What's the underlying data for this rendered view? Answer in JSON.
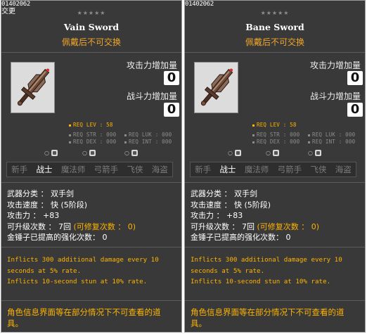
{
  "panels": [
    {
      "item_id": "01402062",
      "sub": "交更",
      "stars": "★★★★★",
      "name": "Vain Sword",
      "trade_note": "佩戴后不可交换",
      "attack_inc_label": "攻击力增加量",
      "attack_inc_value": "0",
      "combat_inc_label": "战斗力增加量",
      "combat_inc_value": "0",
      "req_lev": "REQ LEV :   58",
      "req_str": "REQ STR : 000",
      "req_luk": "REQ LUK : 000",
      "req_dex": "REQ DEX : 000",
      "req_int": "REQ INT : 000",
      "jobs": [
        "新手",
        "战士",
        "魔法师",
        "弓箭手",
        "飞侠",
        "海盗"
      ],
      "active_job": "战士",
      "stats": {
        "category": "武器分类 ： 双手剑",
        "speed": "攻击速度 ： 快 (5阶段)",
        "attack": "攻击力 ： +83",
        "upgrades_prefix": "可升级次数 ： 7回",
        "upgrades_suffix": "(可修复次数 ： 0)",
        "hammer": "金锤子已提高的强化次数： 0"
      },
      "desc_1": " Inflicts 300 additional damage every 10 seconds at 5% rate.",
      "desc_2": "   Inflicts 10-second stun at 10% rate.",
      "note": " 角色信息界面等在部分情况下不可查看的道具。"
    },
    {
      "item_id": "01402062",
      "sub": "",
      "stars": "★★★★★",
      "name": "Bane Sword",
      "trade_note": "佩戴后不可交换",
      "attack_inc_label": "攻击力增加量",
      "attack_inc_value": "0",
      "combat_inc_label": "战斗力增加量",
      "combat_inc_value": "0",
      "req_lev": "REQ LEV :   58",
      "req_str": "REQ STR : 000",
      "req_luk": "REQ LUK : 000",
      "req_dex": "REQ DEX : 000",
      "req_int": "REQ INT : 000",
      "jobs": [
        "新手",
        "战士",
        "魔法师",
        "弓箭手",
        "飞侠",
        "海盗"
      ],
      "active_job": "战士",
      "stats": {
        "category": "武器分类 ： 双手剑",
        "speed": "攻击速度 ： 快 (5阶段)",
        "attack": "攻击力 ： +83",
        "upgrades_prefix": "可升级次数 ： 7回",
        "upgrades_suffix": "(可修复次数 ： 0)",
        "hammer": "金锤子已提高的强化次数： 0"
      },
      "desc_1": " Inflicts 300 additional damage every 10 seconds at 5% rate.",
      "desc_2": "   Inflicts 10-second stun at 10% rate.",
      "note": " 角色信息界面等在部分情况下不可查看的道具。"
    }
  ]
}
